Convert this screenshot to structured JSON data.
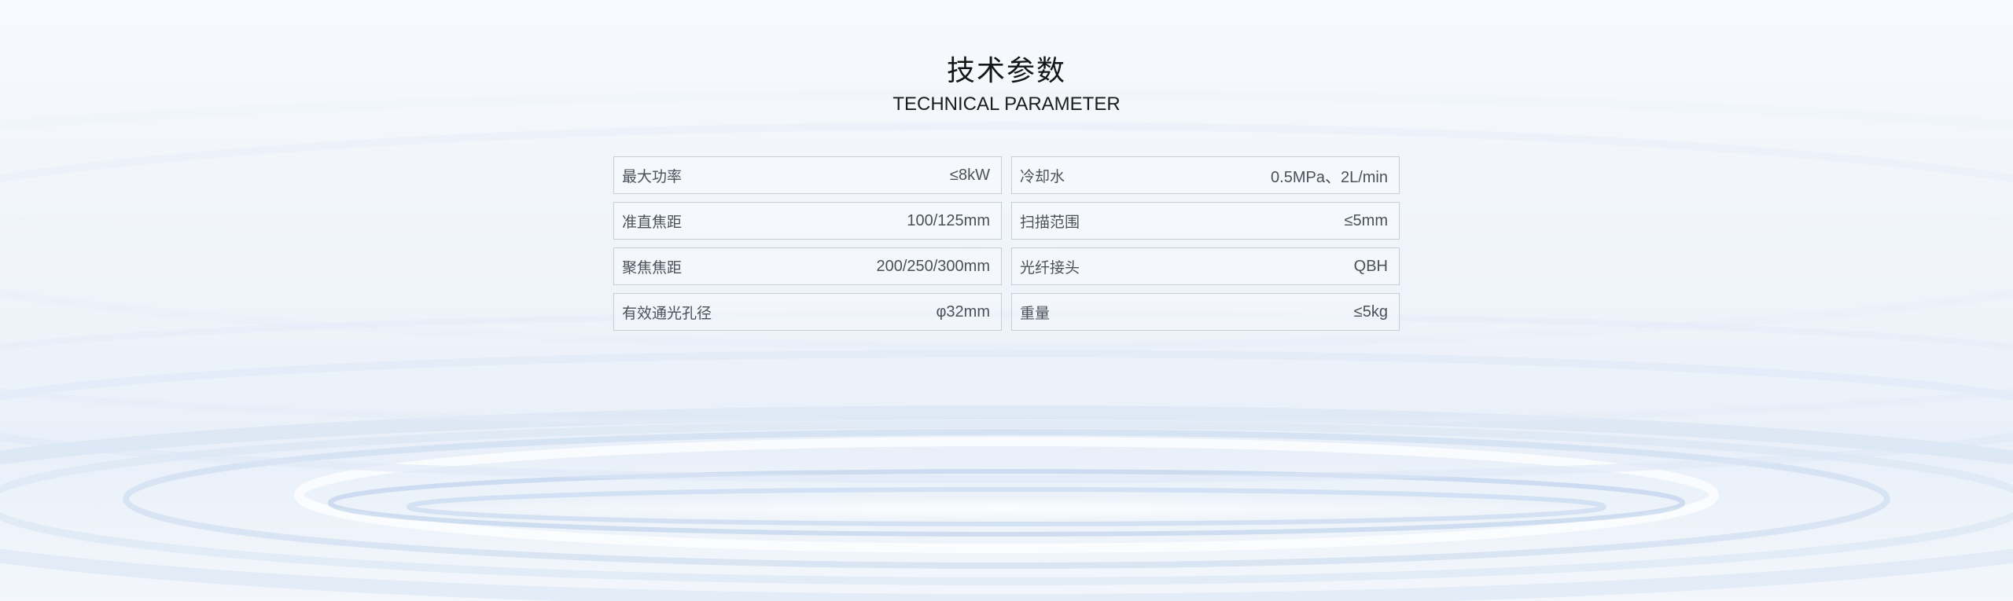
{
  "header": {
    "title_cn": "技术参数",
    "title_en": "TECHNICAL PARAMETER"
  },
  "parameters": [
    {
      "label": "最大功率",
      "value": "≤8kW"
    },
    {
      "label": "冷却水",
      "value": "0.5MPa、2L/min"
    },
    {
      "label": "准直焦距",
      "value": "100/125mm"
    },
    {
      "label": "扫描范围",
      "value": "≤5mm"
    },
    {
      "label": "聚焦焦距",
      "value": "200/250/300mm"
    },
    {
      "label": "光纤接头",
      "value": "QBH"
    },
    {
      "label": "有效通光孔径",
      "value": "φ32mm"
    },
    {
      "label": "重量",
      "value": "≤5kg"
    }
  ],
  "colors": {
    "background": "#f2f6fb",
    "ripple": "#b9cde8",
    "border": "#c7ced8",
    "title": "#151515",
    "text": "#4b515b"
  }
}
